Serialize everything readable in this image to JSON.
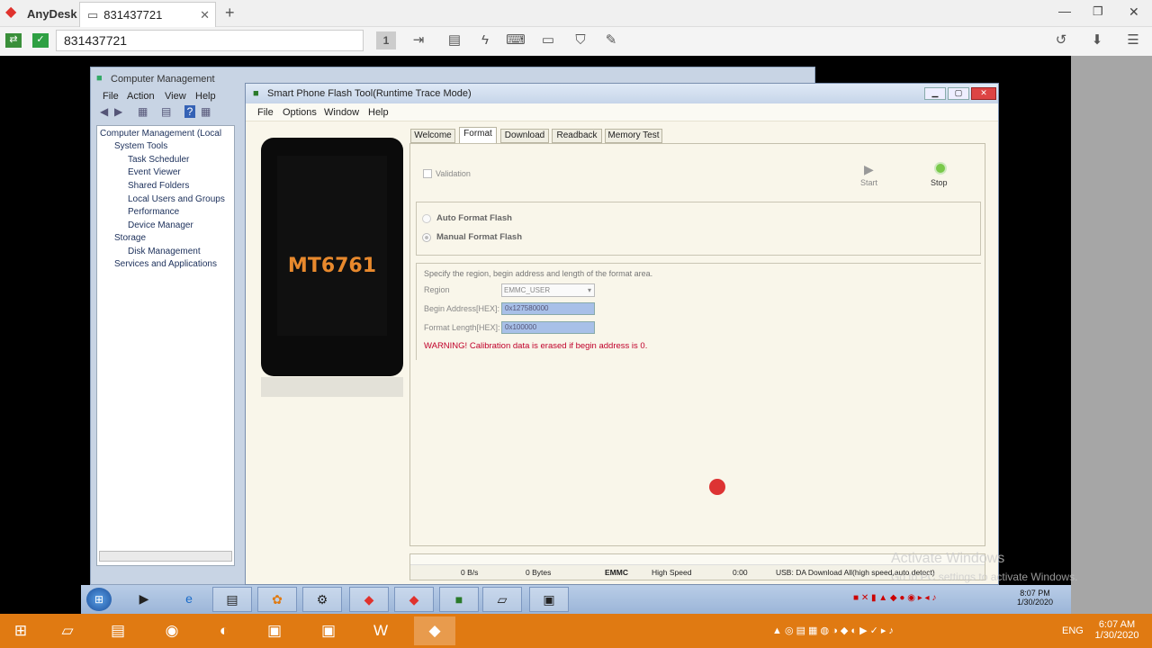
{
  "anydesk": {
    "app_title": "AnyDesk",
    "tab_label": "831437721",
    "address": "831437721",
    "session_number": "1"
  },
  "computer_management": {
    "title": "Computer Management",
    "menu": [
      "File",
      "Action",
      "View",
      "Help"
    ],
    "tree": [
      "Computer Management (Local",
      "System Tools",
      "Task Scheduler",
      "Event Viewer",
      "Shared Folders",
      "Local Users and Groups",
      "Performance",
      "Device Manager",
      "Storage",
      "Disk Management",
      "Services and Applications"
    ]
  },
  "flash_tool": {
    "title": "Smart Phone Flash Tool(Runtime Trace Mode)",
    "menu": [
      "File",
      "Options",
      "Window",
      "Help"
    ],
    "phone_chip": "MT6761",
    "tabs": [
      "Welcome",
      "Format",
      "Download",
      "Readback",
      "Memory Test"
    ],
    "active_tab": "Format",
    "validation_label": "Validation",
    "start_label": "Start",
    "stop_label": "Stop",
    "auto_format": "Auto Format Flash",
    "manual_format": "Manual Format Flash",
    "instruction": "Specify the region, begin address and length of the format area.",
    "region_label": "Region",
    "region_value": "EMMC_USER",
    "begin_label": "Begin Address[HEX]:",
    "begin_value": "0x127580000",
    "length_label": "Format Length[HEX]:",
    "length_value": "0x100000",
    "warning": "WARNING! Calibration data is erased if begin address is 0.",
    "status": {
      "speed": "0 B/s",
      "bytes": "0 Bytes",
      "storage": "EMMC",
      "mode": "High Speed",
      "time": "0:00",
      "usb": "USB: DA Download All(high speed,auto detect)"
    }
  },
  "watermark": {
    "line1": "Activate Windows",
    "line2": "Go to PC settings to activate Windows."
  },
  "remote_clock": {
    "time": "8:07 PM",
    "date": "1/30/2020"
  },
  "local_taskbar": {
    "lang": "ENG",
    "time": "6:07 AM",
    "date": "1/30/2020"
  },
  "colors": {
    "taskbar": "#e07a12",
    "warning": "#c0002a",
    "accent": "#e8892d"
  }
}
